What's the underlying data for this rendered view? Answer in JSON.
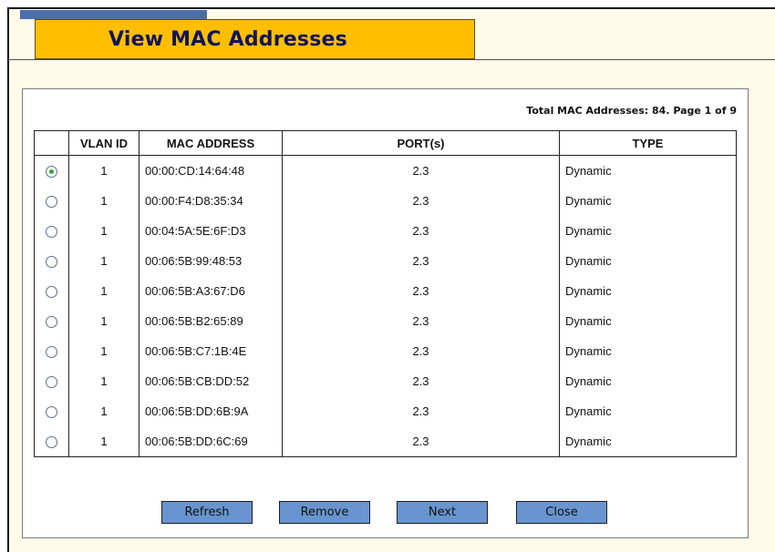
{
  "title": "View MAC Addresses",
  "total_text": "Total MAC Addresses: 84. Page 1 of 9",
  "columns": {
    "select": "",
    "vlan_id": "VLAN ID",
    "mac_address": "MAC ADDRESS",
    "ports": "PORT(s)",
    "type": "TYPE"
  },
  "rows": [
    {
      "selected": true,
      "vlan_id": "1",
      "mac": "00:00:CD:14:64:48",
      "ports": "2.3",
      "type": "Dynamic"
    },
    {
      "selected": false,
      "vlan_id": "1",
      "mac": "00:00:F4:D8:35:34",
      "ports": "2.3",
      "type": "Dynamic"
    },
    {
      "selected": false,
      "vlan_id": "1",
      "mac": "00:04:5A:5E:6F:D3",
      "ports": "2.3",
      "type": "Dynamic"
    },
    {
      "selected": false,
      "vlan_id": "1",
      "mac": "00:06:5B:99:48:53",
      "ports": "2.3",
      "type": "Dynamic"
    },
    {
      "selected": false,
      "vlan_id": "1",
      "mac": "00:06:5B:A3:67:D6",
      "ports": "2.3",
      "type": "Dynamic"
    },
    {
      "selected": false,
      "vlan_id": "1",
      "mac": "00:06:5B:B2:65:89",
      "ports": "2.3",
      "type": "Dynamic"
    },
    {
      "selected": false,
      "vlan_id": "1",
      "mac": "00:06:5B:C7:1B:4E",
      "ports": "2.3",
      "type": "Dynamic"
    },
    {
      "selected": false,
      "vlan_id": "1",
      "mac": "00:06:5B:CB:DD:52",
      "ports": "2.3",
      "type": "Dynamic"
    },
    {
      "selected": false,
      "vlan_id": "1",
      "mac": "00:06:5B:DD:6B:9A",
      "ports": "2.3",
      "type": "Dynamic"
    },
    {
      "selected": false,
      "vlan_id": "1",
      "mac": "00:06:5B:DD:6C:69",
      "ports": "2.3",
      "type": "Dynamic"
    }
  ],
  "buttons": {
    "refresh": "Refresh",
    "remove": "Remove",
    "next": "Next",
    "close": "Close"
  },
  "colors": {
    "title_bg": "#ffbf00",
    "title_text": "#10135e",
    "accent_strip": "#4a6fab",
    "page_bg": "#fffbe8",
    "button_bg": "#6895cf",
    "radio_selected": "#2ea83a"
  }
}
